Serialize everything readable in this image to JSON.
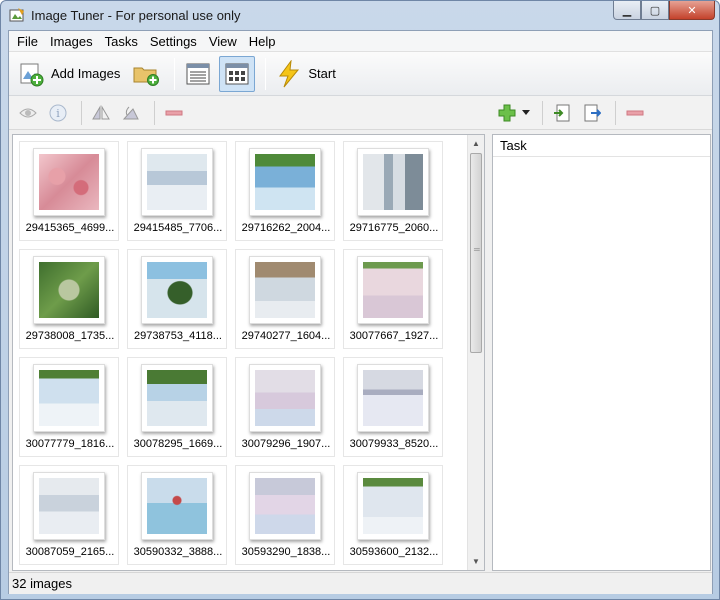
{
  "window": {
    "title": "Image Tuner - For personal use only"
  },
  "menu": [
    "File",
    "Images",
    "Tasks",
    "Settings",
    "View",
    "Help"
  ],
  "toolbar": {
    "add_images_label": "Add Images",
    "start_label": "Start"
  },
  "task_panel": {
    "header": "Task"
  },
  "status": {
    "text": "32 images"
  },
  "thumbnails": [
    "29415365_4699...",
    "29415485_7706...",
    "29716262_2004...",
    "29716775_2060...",
    "29738008_1735...",
    "29738753_4118...",
    "29740277_1604...",
    "30077667_1927...",
    "30077779_1816...",
    "30078295_1669...",
    "30079296_1907...",
    "30079933_8520...",
    "30087059_2165...",
    "30590332_3888...",
    "30593290_1838...",
    "30593600_2132..."
  ],
  "colors": {
    "accent": "#7ba7d3",
    "pressed_bg": "#cfe3f6",
    "close_red": "#c4422b"
  },
  "icons": [
    "app-icon",
    "add-images-icon",
    "add-folder-icon",
    "list-view-icon",
    "thumbnail-view-icon",
    "start-lightning-icon",
    "preview-eye-icon",
    "info-icon",
    "flip-horizontal-icon",
    "flip-vertical-icon",
    "remove-image-icon",
    "add-task-icon",
    "task-dropdown-icon",
    "import-task-icon",
    "export-task-icon",
    "remove-task-icon"
  ]
}
